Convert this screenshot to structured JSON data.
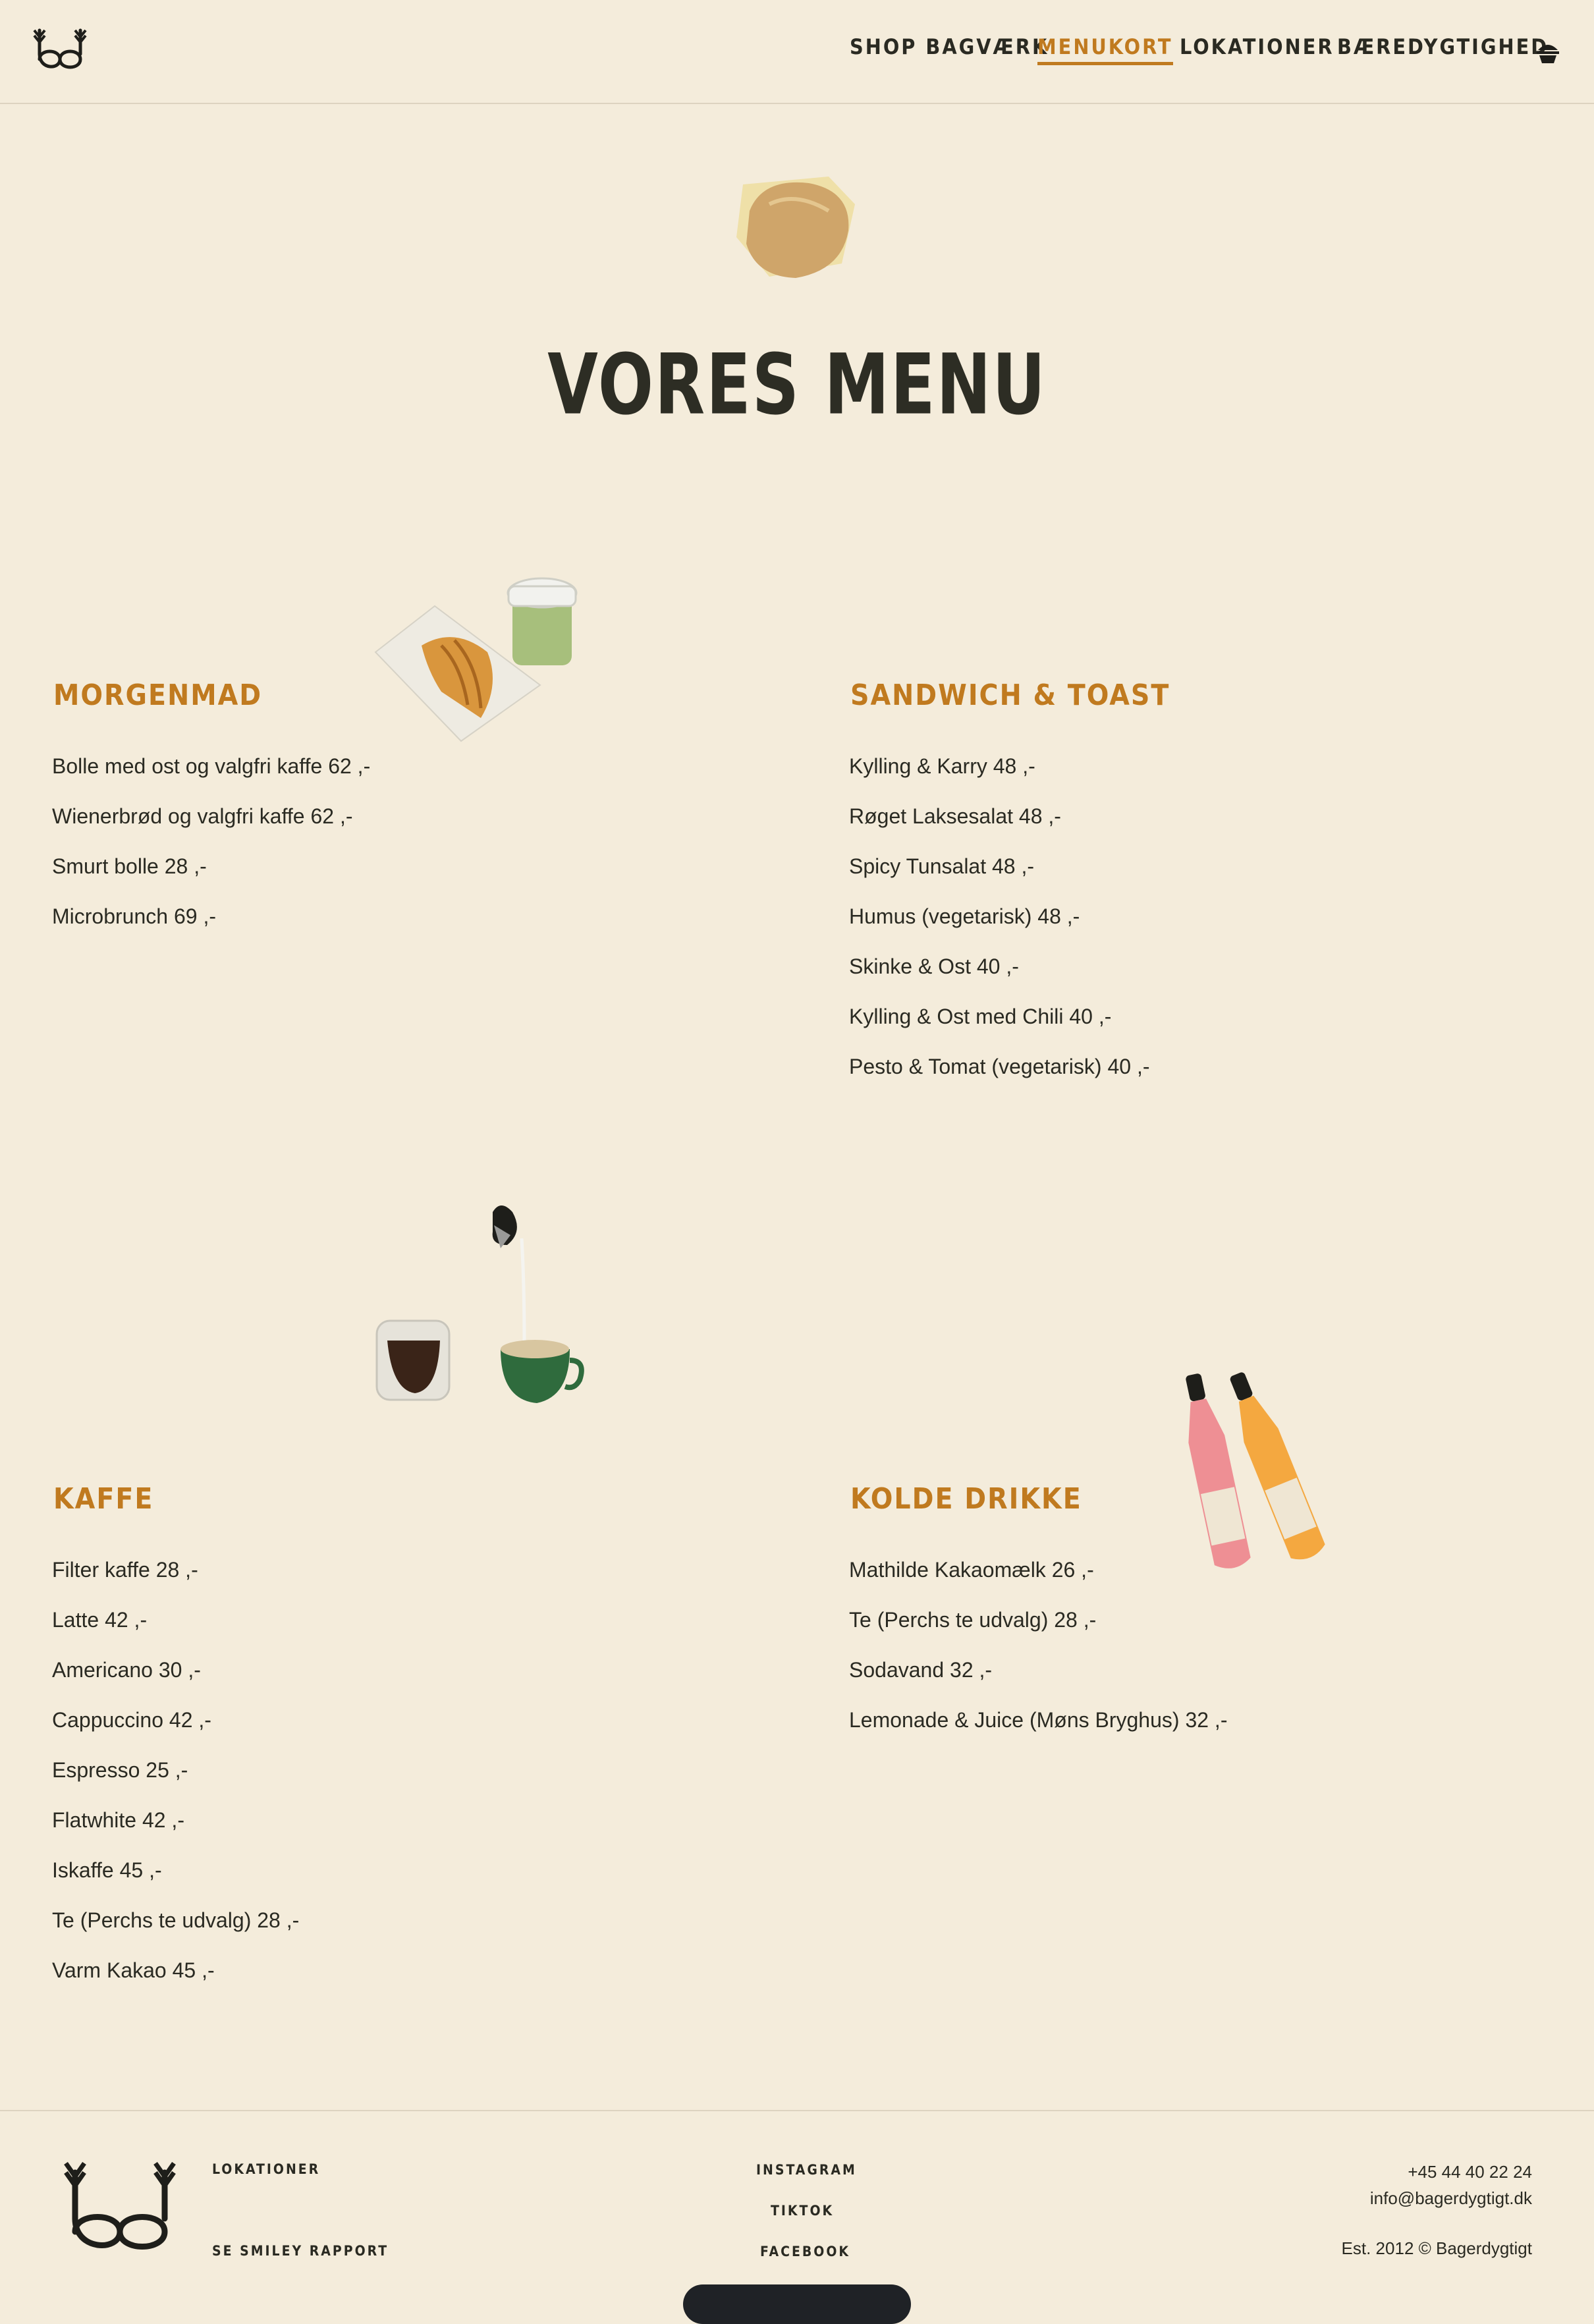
{
  "nav": {
    "items": [
      {
        "label": "SHOP BAGVÆRK",
        "active": false
      },
      {
        "label": "MENUKORT",
        "active": true
      },
      {
        "label": "LOKATIONER",
        "active": false
      },
      {
        "label": "BÆREDYGTIGHED",
        "active": false
      }
    ],
    "cart_icon": "basket-icon",
    "logo_icon": "bakery-logo-icon"
  },
  "page_title": "VORES MENU",
  "sections": {
    "morgenmad": {
      "title": "MORGENMAD",
      "items": [
        "Bolle med ost og valgfri kaffe 62 ,-",
        "Wienerbrød og valgfri kaffe 62 ,-",
        "Smurt bolle 28 ,-",
        "Microbrunch 69 ,-"
      ]
    },
    "sandwich": {
      "title": "SANDWICH & TOAST",
      "items": [
        "Kylling & Karry 48 ,-",
        "Røget Laksesalat 48 ,-",
        "Spicy Tunsalat 48 ,-",
        "Humus (vegetarisk) 48 ,-",
        "Skinke & Ost 40 ,-",
        "Kylling & Ost med Chili 40 ,-",
        "Pesto & Tomat (vegetarisk) 40 ,-"
      ]
    },
    "kaffe": {
      "title": "KAFFE",
      "items": [
        "Filter kaffe 28 ,-",
        "Latte 42 ,-",
        "Americano 30 ,-",
        "Cappuccino 42 ,-",
        "Espresso 25 ,-",
        "Flatwhite 42 ,-",
        "Iskaffe 45 ,-",
        "Te (Perchs te udvalg) 28 ,-",
        "Varm Kakao 45 ,-"
      ]
    },
    "kolde": {
      "title": "KOLDE DRIKKE",
      "items": [
        "Mathilde Kakaomælk 26 ,-",
        "Te (Perchs te udvalg) 28 ,-",
        "Sodavand 32 ,-",
        "Lemonade & Juice (Møns Bryghus) 32 ,-"
      ]
    }
  },
  "footer": {
    "lokationer": "LOKATIONER",
    "smiley": "SE SMILEY RAPPORT",
    "instagram": "INSTAGRAM",
    "tiktok": "TIKTOK",
    "facebook": "FACEBOOK",
    "phone": "+45 44 40 22 24",
    "email": "info@bagerdygtigt.dk",
    "copyright": "Est. 2012 © Bagerdygtigt"
  },
  "colors": {
    "accent": "#c07a1f",
    "background": "#f4ecdb",
    "text": "#2a2a22"
  }
}
